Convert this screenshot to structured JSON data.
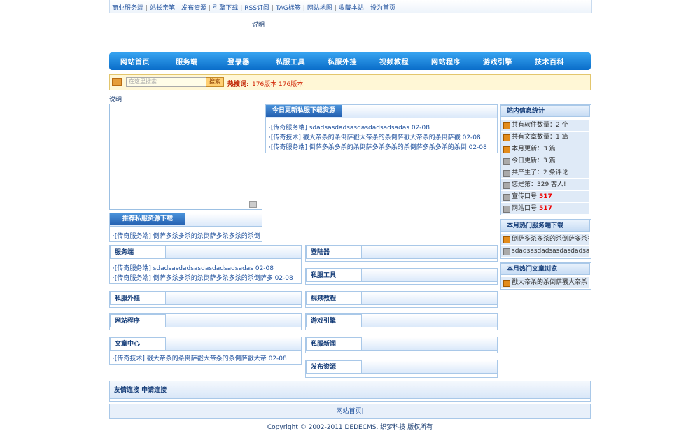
{
  "top_links": [
    "商业服务端",
    "站长亲笔",
    "发布资源",
    "引擎下载",
    "RSS订阅",
    "TAG标签",
    "网站地图",
    "收藏本站",
    "设为首页"
  ],
  "explain_label": "说明",
  "nav": [
    "网站首页",
    "服务端",
    "登录器",
    "私服工具",
    "私服外挂",
    "视频教程",
    "网站程序",
    "游戏引擎",
    "技术百科"
  ],
  "search": {
    "placeholder": "在这里搜索...",
    "button": "搜索",
    "hot_label": "热搜词:",
    "hot_words": "176版本  176版本"
  },
  "today": {
    "title": "今日更新私服下载资源",
    "items": [
      "·[传奇服务端] sdadsasdadsasdasdadsadsadas 02-08",
      "·[传奇技术] 戳大帝杀的杀倒萨戳大帝杀的杀倒萨戳大帝杀的杀倒萨戳 02-08",
      "·[传奇服务端] 倒萨多杀多杀的杀倒萨多杀多杀的杀倒萨多杀多杀的杀倒 02-08"
    ]
  },
  "recommend": {
    "title": "推荐私服资源下载",
    "items": [
      "·[传奇服务端] 倒萨多杀多杀的杀倒萨多杀多杀的杀倒"
    ]
  },
  "stats": {
    "title": "站内信息统计",
    "rows": [
      {
        "label": "共有软件数量：2 个",
        "icon": "orange"
      },
      {
        "label": "共有文章数量：1 篇",
        "icon": "orange"
      },
      {
        "label": "本月更新：3 篇",
        "icon": "orange"
      },
      {
        "label": "今日更新：3 篇",
        "icon": "gray"
      },
      {
        "label": "共产生了：2 条评论",
        "icon": "gray"
      },
      {
        "label": "您是第：329 客人!",
        "icon": "gray"
      },
      {
        "label": "宣传口号:",
        "value": "517",
        "icon": "gray"
      },
      {
        "label": "网站口号:",
        "value": "517",
        "icon": "gray"
      }
    ]
  },
  "hot_server": {
    "title": "本月热门服务端下载",
    "items": [
      "倒萨多杀多杀的杀倒萨多杀多杀",
      "sdadsasdadsasdasdadsadsadas"
    ]
  },
  "hot_article": {
    "title": "本月热门文章浏览",
    "items": [
      "戳大帝杀的杀倒萨戳大帝杀"
    ]
  },
  "sections": {
    "server": {
      "title": "服务端",
      "items": [
        "·[传奇服务端] sdadsasdadsasdasdadsadsadas 02-08",
        "·[传奇服务端] 倒萨多杀多杀的杀倒萨多杀多杀的杀倒萨多 02-08"
      ]
    },
    "login": {
      "title": "登陆器"
    },
    "tools": {
      "title": "私服工具"
    },
    "plugin": {
      "title": "私服外挂"
    },
    "video": {
      "title": "视频教程"
    },
    "program": {
      "title": "网站程序"
    },
    "engine": {
      "title": "游戏引擎"
    },
    "article": {
      "title": "文章中心",
      "items": [
        "·[传奇技术] 戳大帝杀的杀倒萨戳大帝杀的杀倒萨戳大帝 02-08"
      ]
    },
    "news": {
      "title": "私服新闻"
    },
    "publish": {
      "title": "发布资源"
    }
  },
  "links": {
    "title": "友情连接   申请连接"
  },
  "footer_nav": "网站首页|",
  "copyright": "Copyright © 2002-2011 DEDECMS. 织梦科技 版权所有"
}
